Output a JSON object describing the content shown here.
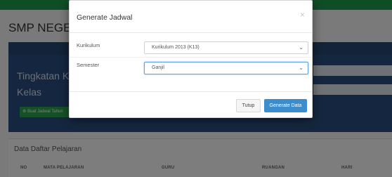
{
  "background": {
    "school_name": "SMP NEGERI 2",
    "tingkatan_label": "Tingkatan Kel",
    "kelas_label": "Kelas",
    "buat_button": "Buat Jadwal Tahun",
    "card_title": "Data Daftar Pelajaran",
    "table_headers": [
      "NO",
      "MATA PELAJARAN",
      "GURU",
      "RUANGAN",
      "HARI"
    ]
  },
  "modal": {
    "title": "Generate Jadwal",
    "close_symbol": "×",
    "fields": {
      "kurikulum": {
        "label": "Kurikulum",
        "value": "Kurikulum 2013 (K13)"
      },
      "semester": {
        "label": "Semester",
        "value": "Ganjil"
      }
    },
    "buttons": {
      "close": "Tutup",
      "generate": "Generate Data"
    }
  },
  "icons": {
    "dropdown": "chevron-down-icon",
    "close": "close-icon"
  },
  "colors": {
    "topbar": "#1f9b4d",
    "panel": "#2b4e80",
    "primary": "#3c8dce",
    "success": "#2aa24c"
  }
}
